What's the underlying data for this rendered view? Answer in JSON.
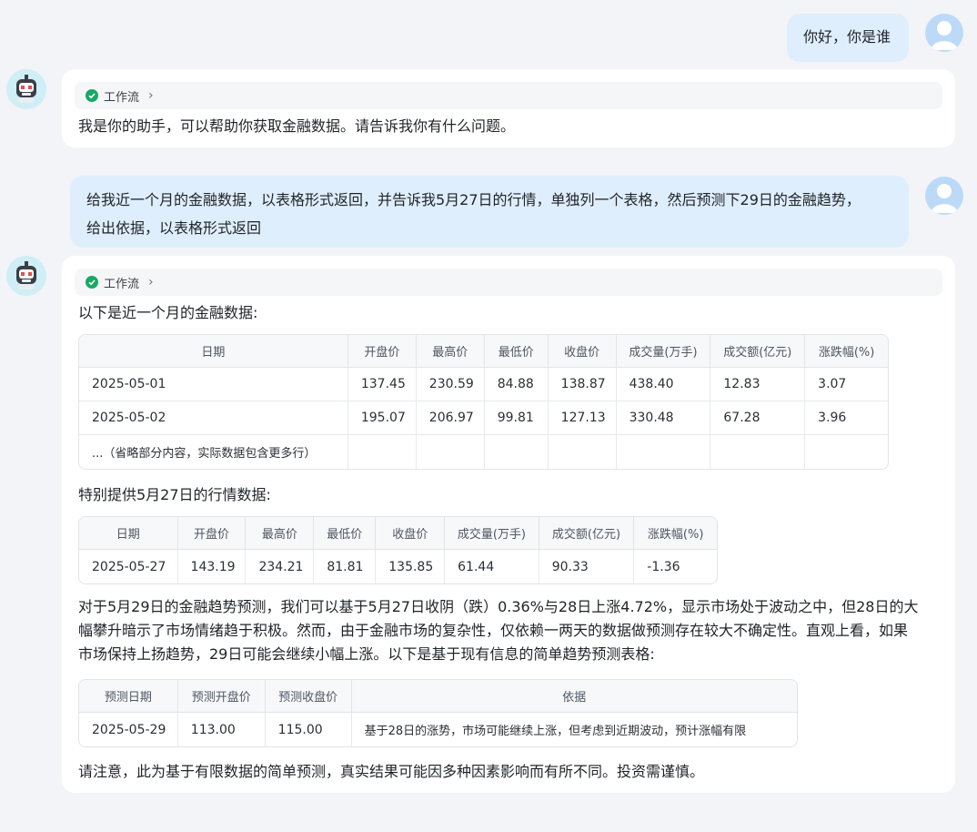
{
  "conversation": {
    "msg1_user": "你好，你是谁",
    "msg1_bot": {
      "workflow": "工作流",
      "text": "我是你的助手，可以帮助你获取金融数据。请告诉我你有什么问题。"
    },
    "msg2_user": {
      "line1": "给我近一个月的金融数据，以表格形式返回，并告诉我5月27日的行情，单独列一个表格，然后预测下29日的金融趋势，",
      "line2": "给出依据，以表格形式返回"
    },
    "msg2_bot": {
      "workflow": "工作流",
      "intro": "以下是近一个月的金融数据:",
      "table1": {
        "headers": [
          "日期",
          "开盘价",
          "最高价",
          "最低价",
          "收盘价",
          "成交量(万手)",
          "成交额(亿元)",
          "涨跌幅(%)"
        ],
        "rows": [
          [
            "2025-05-01",
            "137.45",
            "230.59",
            "84.88",
            "138.87",
            "438.40",
            "12.83",
            "3.07"
          ],
          [
            "2025-05-02",
            "195.07",
            "206.97",
            "99.81",
            "127.13",
            "330.48",
            "67.28",
            "3.96"
          ]
        ],
        "note": "...（省略部分内容，实际数据包含更多行）"
      },
      "special_title": "特别提供5月27日的行情数据:",
      "table2": {
        "headers": [
          "日期",
          "开盘价",
          "最高价",
          "最低价",
          "收盘价",
          "成交量(万手)",
          "成交额(亿元)",
          "涨跌幅(%)"
        ],
        "rows": [
          [
            "2025-05-27",
            "143.19",
            "234.21",
            "81.81",
            "135.85",
            "61.44",
            "90.33",
            "-1.36"
          ]
        ]
      },
      "analysis": {
        "line1": "对于5月29日的金融趋势预测，我们可以基于5月27日收阴（跌）0.36%与28日上涨4.72%，显示市场处于波动之中，但28日的大",
        "line2": "幅攀升暗示了市场情绪趋于积极。然而，由于金融市场的复杂性，仅依赖一两天的数据做预测存在较大不确定性。直观上看，如果",
        "line3": "市场保持上扬趋势，29日可能会继续小幅上涨。以下是基于现有信息的简单趋势预测表格:"
      },
      "table3": {
        "headers": [
          "预测日期",
          "预测开盘价",
          "预测收盘价",
          "依据"
        ],
        "rows": [
          [
            "2025-05-29",
            "113.00",
            "115.00",
            "基于28日的涨势，市场可能继续上涨，但考虑到近期波动，预计涨幅有限"
          ]
        ]
      },
      "disclaimer": "请注意，此为基于有限数据的简单预测，真实结果可能因多种因素影响而有所不同。投资需谨慎。"
    }
  },
  "colors": {
    "user_bubble": "#dfeefc",
    "check_green": "#1aa865",
    "page_bg": "#f3f4f8"
  },
  "icons": [
    "user-avatar-icon",
    "bot-avatar-icon",
    "check-circle-icon",
    "chevron-right-icon"
  ]
}
